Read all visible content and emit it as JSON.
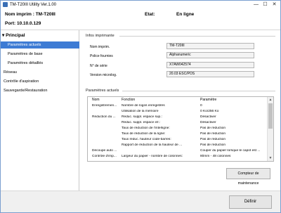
{
  "window": {
    "title": "TM-T20III Utility Ver.1.00",
    "minimize_label": "—",
    "maximize_label": "☐",
    "close_label": "✕"
  },
  "header": {
    "printer_label": "Nom imprim : TM-T20III",
    "port_label": "Port: 10.10.0.129",
    "state_label": "Etat:",
    "state_value": "En ligne"
  },
  "sidebar": {
    "group_label": "▾ Principal",
    "items": [
      {
        "label": "Paramètres actuels",
        "selected": true
      },
      {
        "label": "Paramètres de base",
        "selected": false
      },
      {
        "label": "Paramètres détaillés",
        "selected": false
      },
      {
        "label": "Réseau",
        "selected": false
      },
      {
        "label": "Contrôle d'aspiration",
        "selected": false
      },
      {
        "label": "Sauvegarde/Restauration",
        "selected": false
      }
    ]
  },
  "info": {
    "group_title": "Infos imprimante",
    "rows": [
      {
        "label": "Nom imprim.",
        "value": "TM-T20III"
      },
      {
        "label": "Police fournies",
        "value": "Alphanumeric"
      },
      {
        "label": "N° de série",
        "value": "X7AW042574"
      },
      {
        "label": "Version microlog.",
        "value": "20.03 ESC/POS"
      }
    ]
  },
  "settings": {
    "group_title": "Paramètres actuels",
    "columns": [
      "Nom",
      "Fonction",
      "Paramètre"
    ],
    "rows": [
      [
        "Enregistremen...",
        "Nombre de logos enregistrés",
        "0"
      ],
      [
        "",
        "Utilisation de la mémoire",
        "0 Ko/256 Ko"
      ],
      [
        "Réduction du ...",
        "Réduc. suppl. espace sup.:",
        "Désactiver"
      ],
      [
        "",
        "Réduc. suppl. espace inf.:",
        "Désactiver"
      ],
      [
        "",
        "Taux de réduction de l'interligne:",
        "Pas de réduction"
      ],
      [
        "",
        "Taux de réduction de la ligne:",
        "Pas de réduction"
      ],
      [
        "",
        "Taux réduc. hauteur code-barres:",
        "Pas de réduction"
      ],
      [
        "",
        "Rapport de réduction de la hauteur de ...",
        "Pas de réduction"
      ],
      [
        "Découpe auto ...",
        "",
        "Couper du papier lorsque le capot est ..."
      ],
      [
        "Contrôle d'imp...",
        "Largeur du papier - nombre de colonnes:",
        "80mm - 48 colonnes"
      ]
    ]
  },
  "buttons": {
    "maintenance": "Compteur de maintenance",
    "ok": "Définir"
  }
}
